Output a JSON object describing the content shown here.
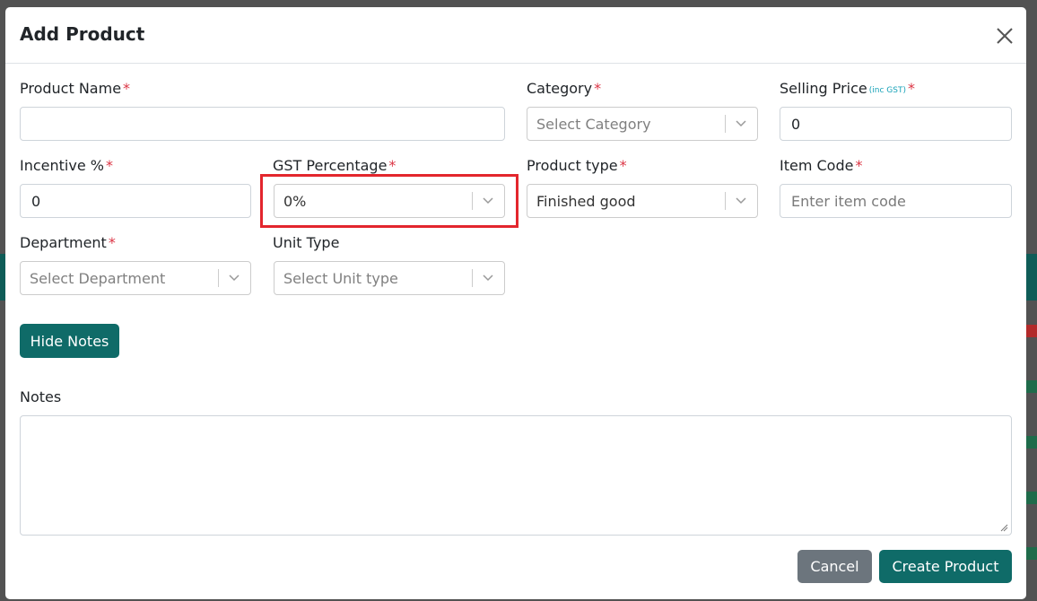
{
  "modal": {
    "title": "Add Product"
  },
  "fields": {
    "product_name": {
      "label": "Product Name",
      "required": "*",
      "value": "",
      "placeholder": ""
    },
    "category": {
      "label": "Category",
      "required": "*",
      "value": "Select Category"
    },
    "selling_price": {
      "label": "Selling Price",
      "note": "(inc GST)",
      "required": "*",
      "value": "0"
    },
    "incentive": {
      "label": "Incentive %",
      "required": "*",
      "value": "0"
    },
    "gst_percentage": {
      "label": "GST Percentage",
      "required": "*",
      "value": "0%"
    },
    "product_type": {
      "label": "Product type",
      "required": "*",
      "value": "Finished good"
    },
    "item_code": {
      "label": "Item Code",
      "required": "*",
      "value": "",
      "placeholder": "Enter item code"
    },
    "department": {
      "label": "Department",
      "required": "*",
      "value": "Select Department"
    },
    "unit_type": {
      "label": "Unit Type",
      "value": "Select Unit type"
    },
    "notes": {
      "label": "Notes",
      "value": ""
    }
  },
  "buttons": {
    "hide_notes": "Hide Notes",
    "cancel": "Cancel",
    "create_product": "Create Product"
  },
  "colors": {
    "primary": "#0f6b68",
    "secondary": "#6c757d",
    "required": "#dc3545",
    "highlight": "#e3262d"
  }
}
